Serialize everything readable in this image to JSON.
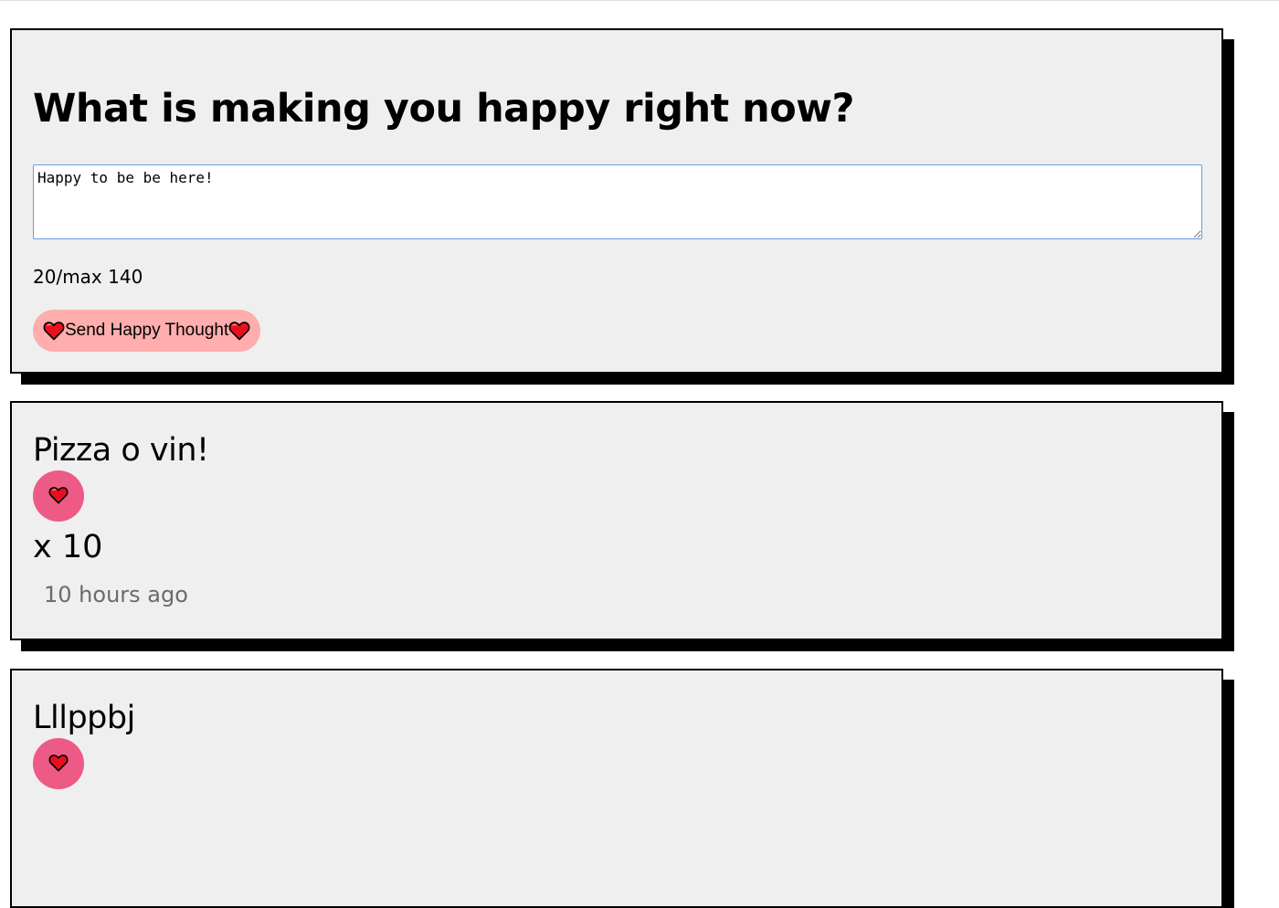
{
  "form": {
    "title": "What is making you happy right now?",
    "input_value": "Happy to be be here!",
    "char_count": "20/max 140",
    "send_label": "Send Happy Thought"
  },
  "thoughts": [
    {
      "text": "Pizza o vin!",
      "likes_label": "x 10",
      "time": "10 hours ago"
    },
    {
      "text": "Lllppbj"
    }
  ],
  "colors": {
    "card_bg": "#efefef",
    "send_button_bg": "#ffadad",
    "like_button_bg": "#ee5a86",
    "heart_red": "#e8101e"
  },
  "icons": {
    "heart": "heart-icon"
  }
}
